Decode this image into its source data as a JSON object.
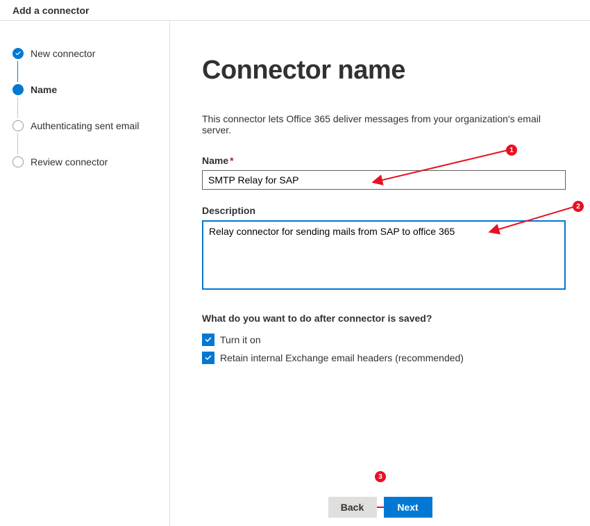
{
  "header": {
    "title": "Add a connector"
  },
  "sidebar": {
    "steps": [
      {
        "label": "New connector",
        "state": "done"
      },
      {
        "label": "Name",
        "state": "active"
      },
      {
        "label": "Authenticating sent email",
        "state": "pending"
      },
      {
        "label": "Review connector",
        "state": "pending"
      }
    ]
  },
  "main": {
    "title": "Connector name",
    "intro": "This connector lets Office 365 deliver messages from your organization's email server.",
    "name_label": "Name",
    "name_value": "SMTP Relay for SAP",
    "description_label": "Description",
    "description_value": "Relay connector for sending mails from SAP to office 365",
    "after_save_question": "What do you want to do after connector is saved?",
    "checkboxes": [
      {
        "label": "Turn it on",
        "checked": true
      },
      {
        "label": "Retain internal Exchange email headers (recommended)",
        "checked": true
      }
    ]
  },
  "footer": {
    "back": "Back",
    "next": "Next"
  },
  "annotations": {
    "badge1": "1",
    "badge2": "2",
    "badge3": "3"
  }
}
